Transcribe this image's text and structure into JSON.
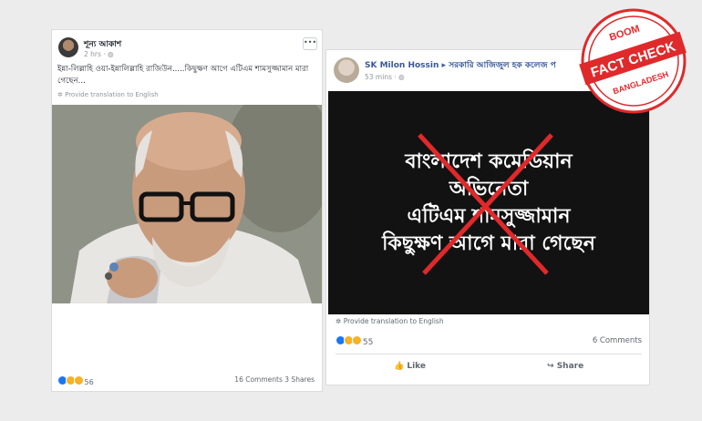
{
  "left_post": {
    "author": "শূন্য আকাশ",
    "time": "2 hrs · ",
    "text": "ইন্না-লিল্লাহি ওয়া-ইন্নালিল্লাহি রাজিউন.....কিছুক্ষণ আগে এটিএম শামসুজ্জামান মারা গেছেন...",
    "translate": "Provide translation to English",
    "reaction_count": "56",
    "comments": "16 Comments",
    "shares": "3 Shares"
  },
  "right_post": {
    "author": "SK Milon Hossin",
    "group": "সরকারি আজিজুল হক কলেজ প",
    "time": "53 mins · ",
    "image_lines": [
      "বাংলাদেশ কমেডিয়ান",
      "অভিনেতা",
      "এটিএম শামসুজ্জামান",
      "কিছুক্ষণ আগে মারা গেছেন"
    ],
    "translate": "Provide translation to English",
    "reaction_count": "55",
    "comments": "6 Comments",
    "like_label": "Like",
    "share_label": "Share"
  },
  "stamp": {
    "boom": "BOOM",
    "fact_check": "FACT CHECK",
    "bangladesh": "BANGLADESH",
    "color": "#e0292b"
  }
}
